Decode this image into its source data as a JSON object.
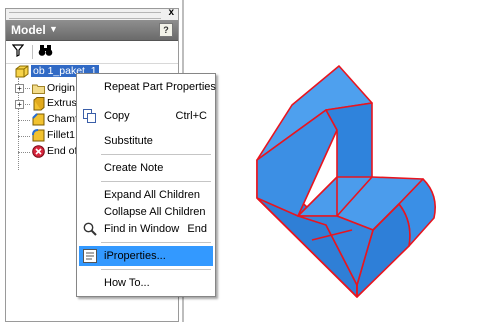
{
  "browser": {
    "title": "Model",
    "help_label": "?",
    "close_label": "x",
    "tree": {
      "root": "ob 1_paket_1",
      "children": [
        {
          "label": "Origin"
        },
        {
          "label": "Extrusic"
        },
        {
          "label": "Chamfe"
        },
        {
          "label": "Fillet1"
        },
        {
          "label": "End of F"
        }
      ]
    }
  },
  "context_menu": {
    "items": [
      {
        "label": "Repeat Part Properties",
        "shortcut": ""
      },
      {
        "label": "Copy",
        "shortcut": "Ctrl+C"
      },
      {
        "label": "Substitute",
        "shortcut": ""
      },
      {
        "label": "Create Note",
        "shortcut": ""
      },
      {
        "label": "Expand All Children",
        "shortcut": ""
      },
      {
        "label": "Collapse All Children",
        "shortcut": ""
      },
      {
        "label": "Find in Window",
        "shortcut": "End"
      },
      {
        "label": "iProperties...",
        "shortcut": ""
      },
      {
        "label": "How To...",
        "shortcut": ""
      }
    ],
    "highlighted": "iProperties..."
  },
  "colors": {
    "part_fill": "#3f93e6",
    "part_edges": "#e8151f",
    "menu_highlight": "#3399ff",
    "selection": "#316ac5"
  }
}
